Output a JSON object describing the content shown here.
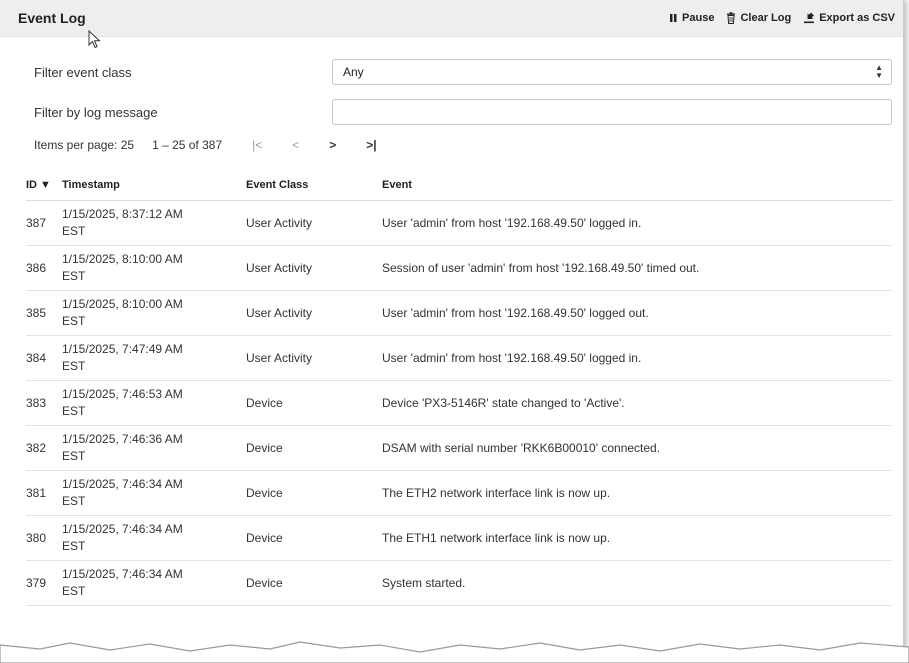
{
  "header": {
    "title": "Event Log",
    "pause_label": "Pause",
    "clear_label": "Clear Log",
    "export_label": "Export as CSV"
  },
  "filters": {
    "class_label": "Filter event class",
    "class_value": "Any",
    "message_label": "Filter by log message",
    "message_value": ""
  },
  "pager": {
    "items_per_page_label": "Items per page: 25",
    "range": "1 – 25 of 387",
    "first": "|<",
    "prev": "<",
    "next": ">",
    "last": ">|"
  },
  "columns": {
    "id": "ID ▼",
    "timestamp": "Timestamp",
    "event_class": "Event Class",
    "event": "Event"
  },
  "rows": [
    {
      "id": "387",
      "ts_line1": "1/15/2025, 8:37:12 AM",
      "ts_line2": "EST",
      "event_class": "User Activity",
      "event": "User 'admin' from host '192.168.49.50' logged in."
    },
    {
      "id": "386",
      "ts_line1": "1/15/2025, 8:10:00 AM",
      "ts_line2": "EST",
      "event_class": "User Activity",
      "event": "Session of user 'admin' from host '192.168.49.50' timed out."
    },
    {
      "id": "385",
      "ts_line1": "1/15/2025, 8:10:00 AM",
      "ts_line2": "EST",
      "event_class": "User Activity",
      "event": "User 'admin' from host '192.168.49.50' logged out."
    },
    {
      "id": "384",
      "ts_line1": "1/15/2025, 7:47:49 AM",
      "ts_line2": "EST",
      "event_class": "User Activity",
      "event": "User 'admin' from host '192.168.49.50' logged in."
    },
    {
      "id": "383",
      "ts_line1": "1/15/2025, 7:46:53 AM",
      "ts_line2": "EST",
      "event_class": "Device",
      "event": "Device 'PX3-5146R' state changed to 'Active'."
    },
    {
      "id": "382",
      "ts_line1": "1/15/2025, 7:46:36 AM",
      "ts_line2": "EST",
      "event_class": "Device",
      "event": "DSAM with serial number 'RKK6B00010' connected."
    },
    {
      "id": "381",
      "ts_line1": "1/15/2025, 7:46:34 AM",
      "ts_line2": "EST",
      "event_class": "Device",
      "event": "The ETH2 network interface link is now up."
    },
    {
      "id": "380",
      "ts_line1": "1/15/2025, 7:46:34 AM",
      "ts_line2": "EST",
      "event_class": "Device",
      "event": "The ETH1 network interface link is now up."
    },
    {
      "id": "379",
      "ts_line1": "1/15/2025, 7:46:34 AM",
      "ts_line2": "EST",
      "event_class": "Device",
      "event": "System started."
    }
  ]
}
